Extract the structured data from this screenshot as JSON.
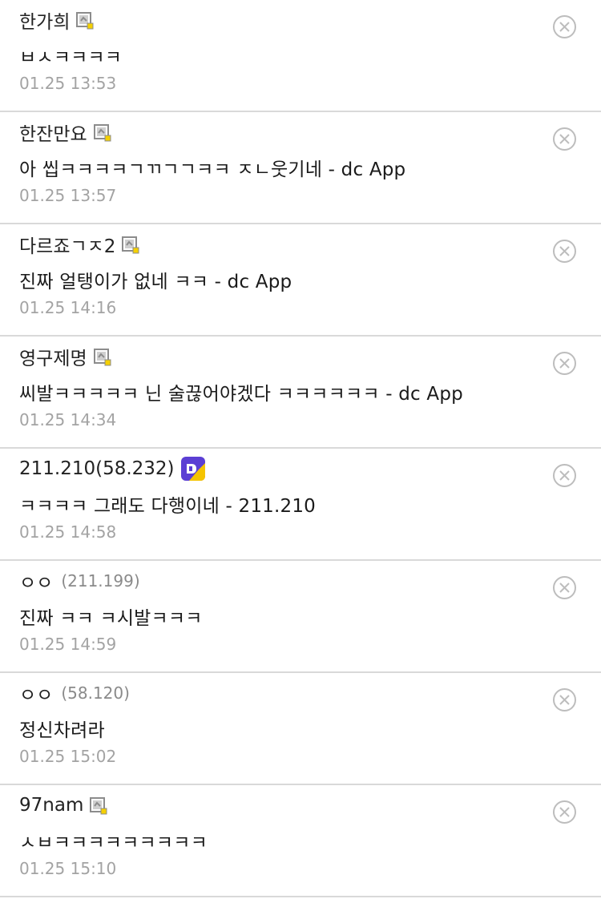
{
  "comments": [
    {
      "author": "한가희",
      "ip": "",
      "badge": "gallog-icon",
      "text": "ㅂㅅㅋㅋㅋㅋ",
      "date": "01.25 13:53"
    },
    {
      "author": "한잔만요",
      "ip": "",
      "badge": "gallog-icon",
      "text": "아 씹ㅋㅋㅋㅋㄱㄲㄱㄱㅋㅋ ㅈㄴ웃기네 - dc App",
      "date": "01.25 13:57"
    },
    {
      "author": "다르죠ㄱㅈ2",
      "ip": "",
      "badge": "gallog-icon",
      "text": "진짜 얼탱이가 없네 ㅋㅋ - dc App",
      "date": "01.25 14:16"
    },
    {
      "author": "영구제명",
      "ip": "",
      "badge": "gallog-icon",
      "text": "씨발ㅋㅋㅋㅋㅋ 닌 술끊어야겠다 ㅋㅋㅋㅋㅋㅋ - dc App",
      "date": "01.25 14:34"
    },
    {
      "author": "211.210(58.232)",
      "ip": "",
      "badge": "dc-app-icon",
      "text": "ㅋㅋㅋㅋ 그래도 다행이네 - 211.210",
      "date": "01.25 14:58"
    },
    {
      "author": "ㅇㅇ",
      "ip": "(211.199)",
      "badge": "",
      "text": "진짜 ㅋㅋ ㅋ시발ㅋㅋㅋ",
      "date": "01.25 14:59"
    },
    {
      "author": "ㅇㅇ",
      "ip": "(58.120)",
      "badge": "",
      "text": "정신차려라",
      "date": "01.25 15:02"
    },
    {
      "author": "97nam",
      "ip": "",
      "badge": "gallog-icon",
      "text": "ㅅㅂㅋㅋㅋㅋㅋㅋㅋㅋㅋ",
      "date": "01.25 15:10"
    }
  ],
  "colors": {
    "divider": "#d9d9d9",
    "date": "#a3a3a3",
    "ip": "#8a8a8a",
    "badge_accent": "#f5d000",
    "app_icon": "#5b3fd4"
  }
}
